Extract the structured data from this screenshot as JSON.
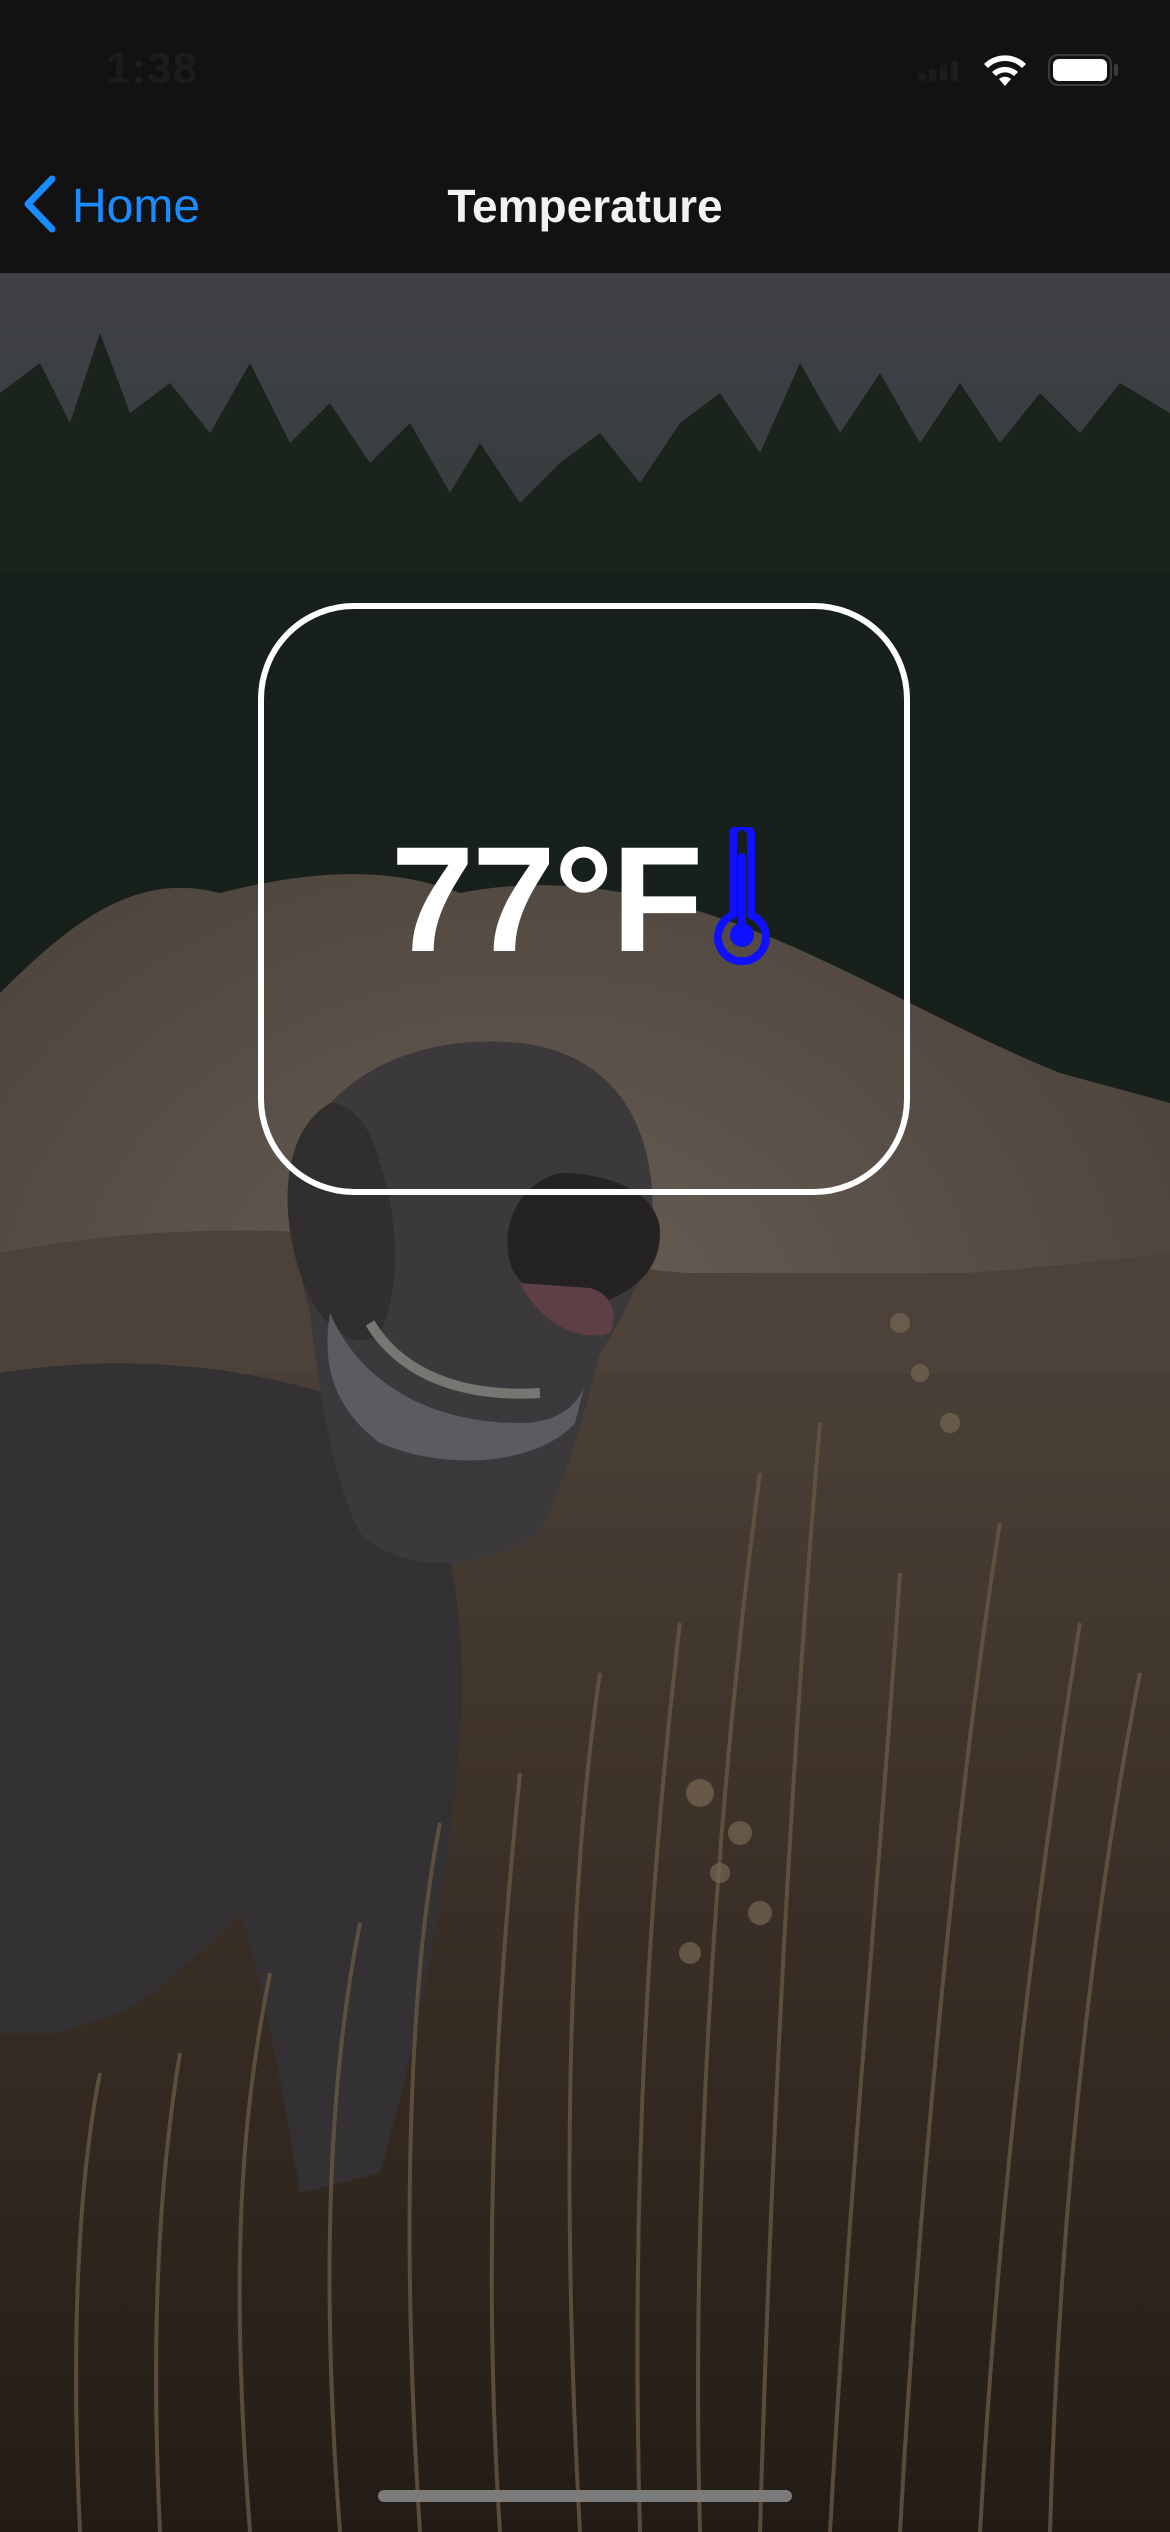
{
  "status_bar": {
    "time": "1:38",
    "wifi_icon": "wifi-icon",
    "battery_icon": "battery-icon"
  },
  "nav": {
    "back_label": "Home",
    "back_icon": "chevron-left-icon",
    "title": "Temperature"
  },
  "temperature": {
    "value": "77°F",
    "icon": "thermometer-icon",
    "icon_color": "#1010ff"
  },
  "colors": {
    "accent": "#1a8cff",
    "background": "#121212"
  }
}
